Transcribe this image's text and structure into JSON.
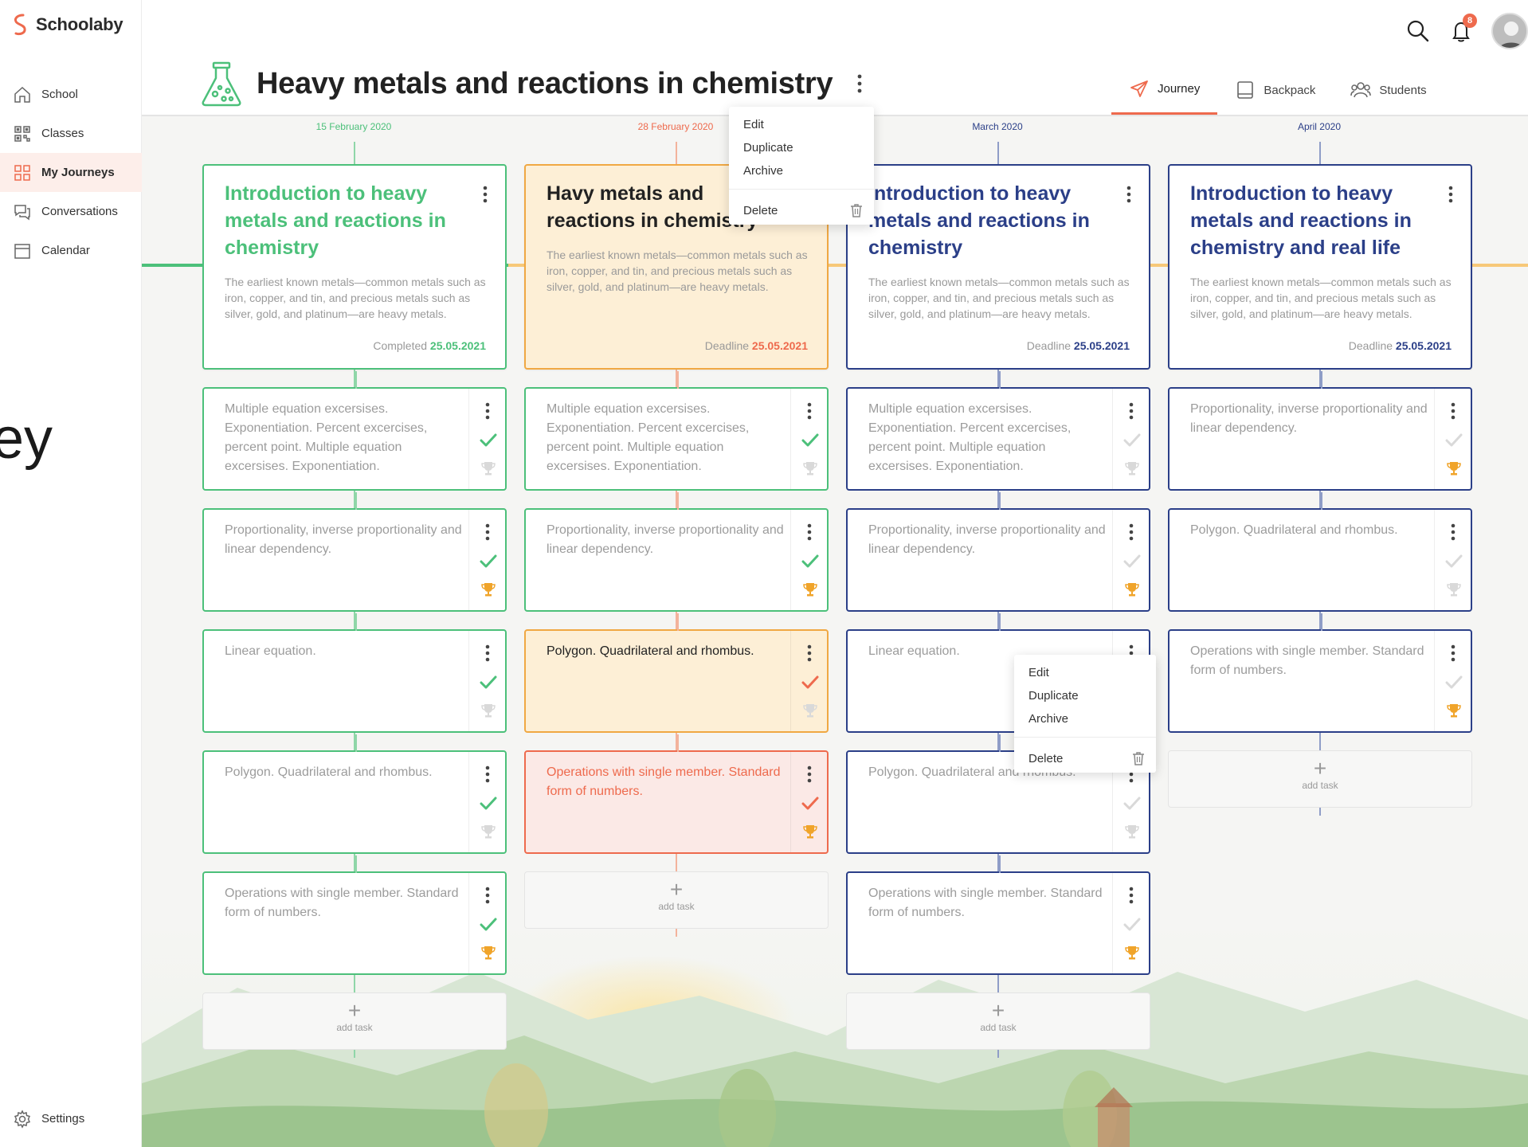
{
  "app": {
    "name": "Schoolaby",
    "notification_count": "8"
  },
  "overlay_text": "ey",
  "nav": [
    {
      "label": "School",
      "icon": "home-icon"
    },
    {
      "label": "Classes",
      "icon": "qr-grid-icon"
    },
    {
      "label": "My Journeys",
      "icon": "grid-icon",
      "active": true
    },
    {
      "label": "Conversations",
      "icon": "chat-icon"
    },
    {
      "label": "Calendar",
      "icon": "calendar-icon"
    }
  ],
  "settings_label": "Settings",
  "page_title": "Heavy metals and reactions in chemistry",
  "tabs": [
    {
      "label": "Journey",
      "icon": "paper-plane-icon",
      "active": true
    },
    {
      "label": "Backpack",
      "icon": "backpack-icon"
    },
    {
      "label": "Students",
      "icon": "students-icon"
    }
  ],
  "menu_items": {
    "edit": "Edit",
    "duplicate": "Duplicate",
    "archive": "Archive",
    "delete": "Delete"
  },
  "add_task_label": "add task",
  "colors": {
    "green": "#4cc07a",
    "orange": "#f0a843",
    "red": "#ee6a4d",
    "navy": "#2b3f88",
    "trophy": "#f0a42a",
    "muted": "#d9d9d9"
  },
  "columns": [
    {
      "date": "15 February 2020",
      "title": "Introduction to heavy metals and reactions in chemistry",
      "description": "The earliest known metals—common metals such as iron, copper, and tin, and precious metals such as silver, gold, and platinum—are heavy metals.",
      "status_label": "Completed",
      "status_date": "25.05.2021",
      "tasks": [
        {
          "text": "Multiple equation excersises. Exponentiation. Percent excercises, percent point. Multiple equation excersises. Exponentiation."
        },
        {
          "text": "Proportionality, inverse proportionality and linear dependency."
        },
        {
          "text": "Linear equation."
        },
        {
          "text": "Polygon. Quadrilateral and rhombus."
        },
        {
          "text": "Operations with single member. Standard form of numbers."
        }
      ]
    },
    {
      "date": "28 February 2020",
      "title": "Havy metals and reactions in chemistry",
      "description": "The earliest known metals—common metals such as iron, copper, and tin, and precious metals such as silver, gold, and platinum—are heavy metals.",
      "status_label": "Deadline",
      "status_date": "25.05.2021",
      "tasks": [
        {
          "text": "Multiple equation excersises. Exponentiation. Percent excercises, percent point. Multiple equation excersises. Exponentiation."
        },
        {
          "text": "Proportionality, inverse proportionality and linear dependency."
        },
        {
          "text": "Polygon. Quadrilateral and rhombus."
        },
        {
          "text": "Operations with single member. Standard form of numbers."
        }
      ]
    },
    {
      "date": "March 2020",
      "title": "Introduction to heavy metals and reactions in chemistry",
      "description": "The earliest known metals—common metals such as iron, copper, and tin, and precious metals such as silver, gold, and platinum—are heavy metals.",
      "status_label": "Deadline",
      "status_date": "25.05.2021",
      "tasks": [
        {
          "text": "Multiple equation excersises. Exponentiation. Percent excercises, percent point. Multiple equation excersises. Exponentiation."
        },
        {
          "text": "Proportionality, inverse proportionality and linear dependency."
        },
        {
          "text": "Linear equation."
        },
        {
          "text": "Polygon. Quadrilateral and rhombus."
        },
        {
          "text": "Operations with single member. Standard form of numbers."
        }
      ]
    },
    {
      "date": "April 2020",
      "title": "Introduction to heavy metals and reactions in chemistry and real life",
      "description": "The earliest known metals—common metals such as iron, copper, and tin, and precious metals such as silver, gold, and platinum—are heavy metals.",
      "status_label": "Deadline",
      "status_date": "25.05.2021",
      "tasks": [
        {
          "text": "Proportionality, inverse proportionality and linear dependency."
        },
        {
          "text": "Polygon. Quadrilateral and rhombus."
        },
        {
          "text": "Operations with single member. Standard form of numbers."
        }
      ]
    }
  ]
}
